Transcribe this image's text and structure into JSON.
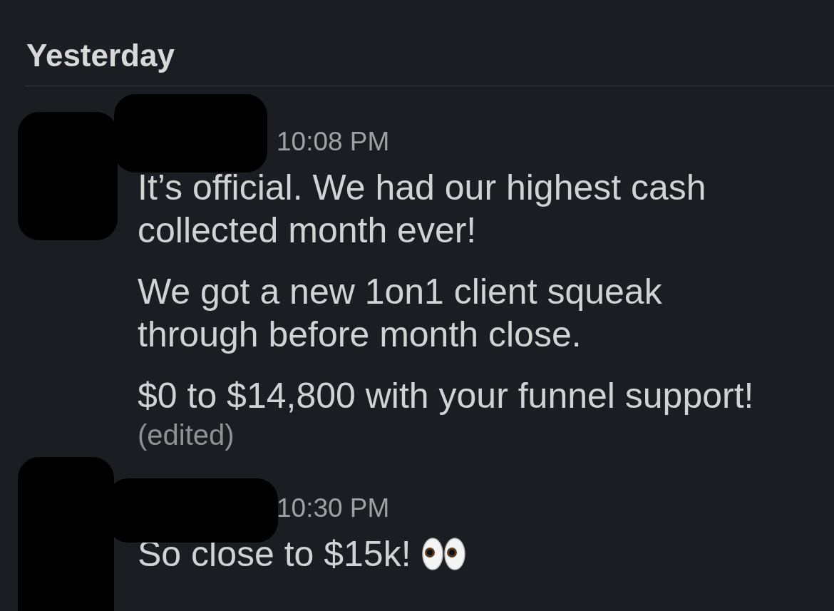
{
  "day_divider": {
    "label": "Yesterday"
  },
  "messages": [
    {
      "time": "10:08 PM",
      "paragraphs": [
        [
          "It’s official. We had our highest cash",
          "collected month ever!"
        ],
        [
          "We got a new 1on1 client squeak",
          "through before month close."
        ],
        [
          "$0 to $14,800 with your funnel support!"
        ]
      ],
      "edited": "(edited)",
      "emoji": false
    },
    {
      "time": "10:30 PM",
      "paragraphs": [
        [
          "So close to $15k!"
        ]
      ],
      "emoji": true
    }
  ]
}
